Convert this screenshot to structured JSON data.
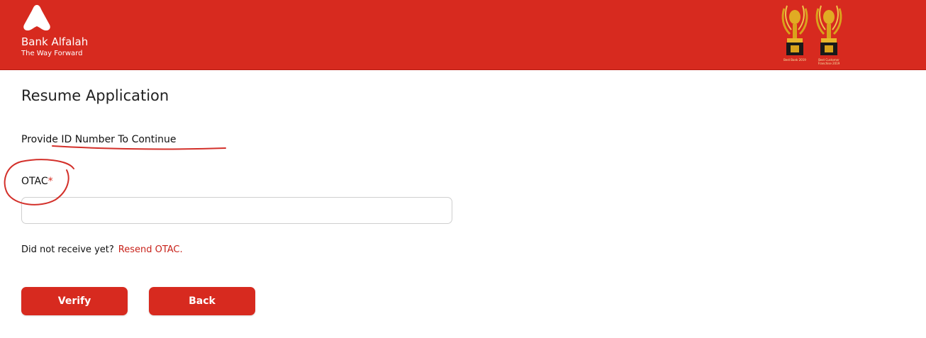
{
  "header": {
    "brand_name": "Bank Alfalah",
    "brand_tagline": "The Way Forward",
    "awards": [
      {
        "caption": "Best Bank 2019",
        "icon": "trophy-icon"
      },
      {
        "caption": "Best Customer Franchise 2019",
        "icon": "trophy-icon"
      }
    ]
  },
  "main": {
    "title": "Resume Application",
    "subtitle": "Provide ID Number To Continue",
    "otac_label": "OTAC",
    "otac_required_marker": "*",
    "otac_value": "",
    "resend_prompt": "Did not receive yet?",
    "resend_link": "Resend OTAC.",
    "verify_label": "Verify",
    "back_label": "Back"
  },
  "colors": {
    "brand_red": "#d72a1f",
    "annotation_red": "#d3302a",
    "award_gold": "#d9a21b"
  }
}
